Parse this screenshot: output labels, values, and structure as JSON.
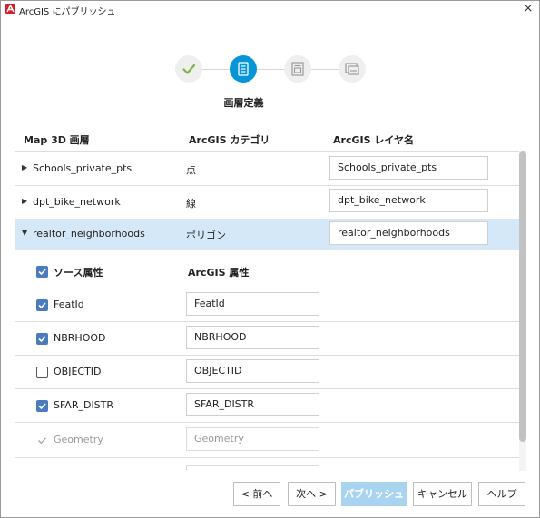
{
  "window": {
    "title": "ArcGIS にパブリッシュ",
    "close_label": "×"
  },
  "stepper": {
    "current_step_label": "画層定義",
    "steps": [
      {
        "icon": "checkmark-icon",
        "state": "done"
      },
      {
        "icon": "layer-definition-icon",
        "state": "active"
      },
      {
        "icon": "properties-icon",
        "state": "pending"
      },
      {
        "icon": "publish-icon",
        "state": "pending"
      }
    ],
    "colors": {
      "done": "#7cb342",
      "active": "#0696d7",
      "pending": "#9a9a9a"
    }
  },
  "columns": {
    "layer": "Map 3D 画層",
    "category": "ArcGIS カテゴリ",
    "layer_name": "ArcGIS レイヤ名"
  },
  "layers": [
    {
      "name": "Schools_private_pts",
      "category": "点",
      "arcgis_name": "Schools_private_pts",
      "expanded": false,
      "selected": false
    },
    {
      "name": "dpt_bike_network",
      "category": "線",
      "arcgis_name": "dpt_bike_network",
      "expanded": false,
      "selected": false
    },
    {
      "name": "realtor_neighborhoods",
      "category": "ポリゴン",
      "arcgis_name": "realtor_neighborhoods",
      "expanded": true,
      "selected": true
    }
  ],
  "attributes": {
    "header_source": "ソース属性",
    "header_arcgis": "ArcGIS 属性",
    "header_checked": true,
    "items": [
      {
        "name": "FeatId",
        "arcgis": "FeatId",
        "checked": true,
        "disabled": false
      },
      {
        "name": "NBRHOOD",
        "arcgis": "NBRHOOD",
        "checked": true,
        "disabled": false
      },
      {
        "name": "OBJECTID",
        "arcgis": "OBJECTID",
        "checked": false,
        "disabled": false
      },
      {
        "name": "SFAR_DISTR",
        "arcgis": "SFAR_DISTR",
        "checked": true,
        "disabled": false
      },
      {
        "name": "Geometry",
        "arcgis": "Geometry",
        "checked": true,
        "disabled": true
      }
    ]
  },
  "buttons": {
    "back": "< 前へ",
    "next": "次へ >",
    "publish": "パブリッシュ",
    "cancel": "キャンセル",
    "help": "ヘルプ"
  },
  "colors": {
    "selected_row": "#d4e8f7",
    "checkbox": "#4b7bbf",
    "brand": "#d4202c",
    "publish_disabled": "#a9d4f0"
  }
}
